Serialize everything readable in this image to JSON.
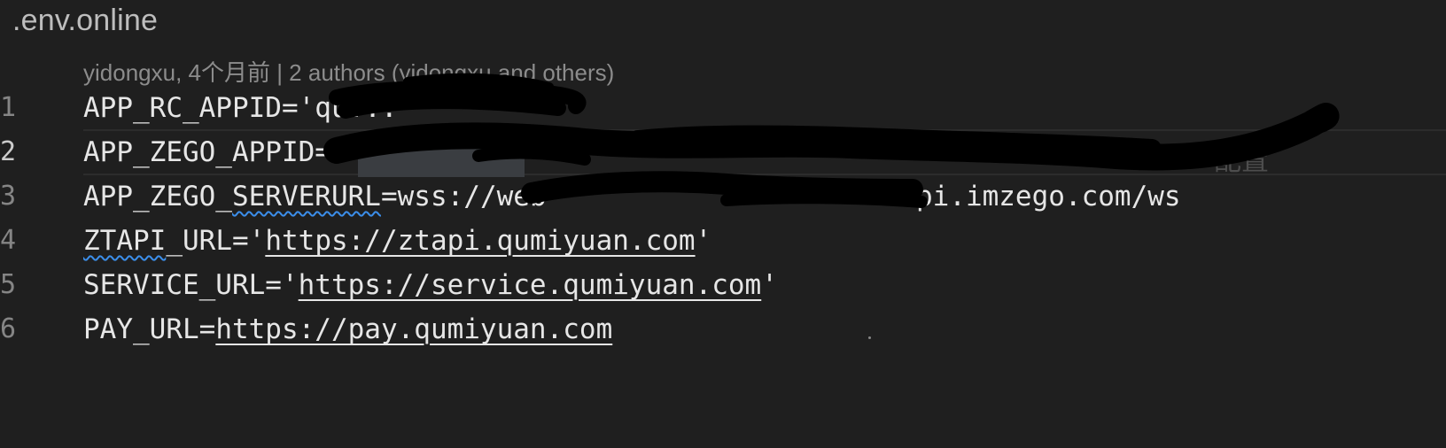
{
  "file": {
    "name": ".env.online"
  },
  "codelens": "yidongxu, 4个月前 | 2 authors (yidongxu and others)",
  "lines": [
    {
      "number": "1",
      "key": "APP_RC_APPID=",
      "value": "'qu...'"
    },
    {
      "number": "2",
      "key": "APP_ZEGO_APPID=",
      "value": ""
    },
    {
      "number": "3",
      "key": "APP_ZEGO_SERVERURL=",
      "value_prefix": "wss://web",
      "value_suffix": "-api.imzego.com/ws"
    },
    {
      "number": "4",
      "key": "ZTAPI_URL=",
      "quote": "'",
      "url": "https://ztapi.qumiyuan.com"
    },
    {
      "number": "5",
      "key": "SERVICE_URL=",
      "quote": "'",
      "url": "https://service.qumiyuan.com"
    },
    {
      "number": "6",
      "key": "PAY_URL=",
      "url": "https://pay.qumiyuan.com"
    }
  ],
  "blame_hint": "配置",
  "colors": {
    "background": "#1f1f1f",
    "squiggle": "#3b8eea",
    "text": "#e6e6e6"
  }
}
